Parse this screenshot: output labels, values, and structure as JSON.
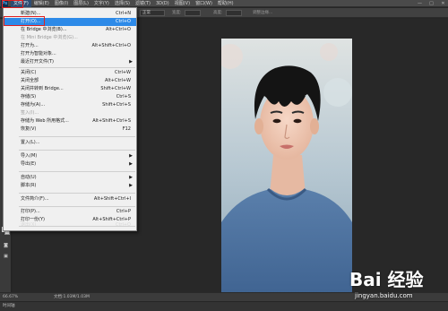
{
  "app": {
    "logo": "Ps"
  },
  "menubar": {
    "items": [
      "文件(F)",
      "编辑(E)",
      "图像(I)",
      "图层(L)",
      "文字(Y)",
      "选择(S)",
      "滤镜(T)",
      "3D(D)",
      "视图(V)",
      "窗口(W)",
      "帮助(H)"
    ],
    "active_index": 0,
    "window_controls": [
      "—",
      "□",
      "✕"
    ]
  },
  "options_bar": {
    "mode_value": "正常",
    "width_label": "宽度:",
    "height_label": "高度:",
    "adjust_label": "调整边缘..."
  },
  "file_menu": {
    "items": [
      {
        "label": "新建(N)...",
        "shortcut": "Ctrl+N",
        "state": "normal"
      },
      {
        "label": "打开(O)...",
        "shortcut": "Ctrl+O",
        "state": "highlight"
      },
      {
        "label": "在 Bridge 中浏览(B)...",
        "shortcut": "Alt+Ctrl+O",
        "state": "normal"
      },
      {
        "label": "在 Mini Bridge 中浏览(G)...",
        "shortcut": "",
        "state": "disabled"
      },
      {
        "label": "打开为...",
        "shortcut": "Alt+Shift+Ctrl+O",
        "state": "normal"
      },
      {
        "label": "打开为智能对象...",
        "shortcut": "",
        "state": "normal"
      },
      {
        "label": "最近打开文件(T)",
        "shortcut": "",
        "state": "submenu"
      },
      {
        "label": "关闭(C)",
        "shortcut": "Ctrl+W",
        "state": "normal"
      },
      {
        "label": "关闭全部",
        "shortcut": "Alt+Ctrl+W",
        "state": "normal"
      },
      {
        "label": "关闭并转到 Bridge...",
        "shortcut": "Shift+Ctrl+W",
        "state": "normal"
      },
      {
        "label": "存储(S)",
        "shortcut": "Ctrl+S",
        "state": "normal"
      },
      {
        "label": "存储为(A)...",
        "shortcut": "Shift+Ctrl+S",
        "state": "normal"
      },
      {
        "label": "签入(I)...",
        "shortcut": "",
        "state": "disabled"
      },
      {
        "label": "存储为 Web 所用格式...",
        "shortcut": "Alt+Shift+Ctrl+S",
        "state": "normal"
      },
      {
        "label": "恢复(V)",
        "shortcut": "F12",
        "state": "normal"
      },
      {
        "label": "置入(L)...",
        "shortcut": "",
        "state": "normal"
      },
      {
        "label": "导入(M)",
        "shortcut": "",
        "state": "submenu"
      },
      {
        "label": "导出(E)",
        "shortcut": "",
        "state": "submenu"
      },
      {
        "label": "自动(U)",
        "shortcut": "",
        "state": "submenu"
      },
      {
        "label": "脚本(R)",
        "shortcut": "",
        "state": "submenu"
      },
      {
        "label": "文件简介(F)...",
        "shortcut": "Alt+Shift+Ctrl+I",
        "state": "normal"
      },
      {
        "label": "打印(P)...",
        "shortcut": "Ctrl+P",
        "state": "normal"
      },
      {
        "label": "打印一份(Y)",
        "shortcut": "Alt+Shift+Ctrl+P",
        "state": "normal"
      },
      {
        "label": "退出(X)",
        "shortcut": "Ctrl+Q",
        "state": "normal"
      }
    ]
  },
  "status_bar": {
    "zoom": "66.67%",
    "doc_info": "文档:1.03M/1.03M"
  },
  "timeline": {
    "label": "时间轴"
  },
  "watermark": {
    "logo_text": "Bai 经验",
    "url": "jingyan.baidu.com"
  },
  "colors": {
    "highlight": "#2d8ae8",
    "annotation_red": "#e02020",
    "menu_bg": "#f0f0f0"
  }
}
